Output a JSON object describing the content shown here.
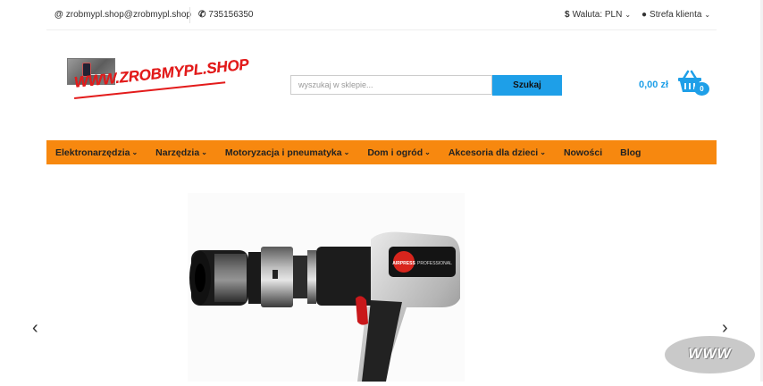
{
  "topbar": {
    "email": "zrobmypl.shop@zrobmypl.shop",
    "phone": "735156350",
    "currency_label": "Waluta: PLN",
    "account_label": "Strefa klienta"
  },
  "logo": {
    "text": "WWW.ZROBMYPL.SHOP"
  },
  "search": {
    "placeholder": "wyszukaj w sklepie...",
    "button_label": "Szukaj"
  },
  "cart": {
    "total": "0,00 zł",
    "count": "0"
  },
  "nav": {
    "items": [
      {
        "label": "Elektronarzędzia",
        "dropdown": true
      },
      {
        "label": "Narzędzia",
        "dropdown": true
      },
      {
        "label": "Motoryzacja i pneumatyka",
        "dropdown": true
      },
      {
        "label": "Dom i ogród",
        "dropdown": true
      },
      {
        "label": "Akcesoria dla dzieci",
        "dropdown": true
      },
      {
        "label": "Nowości",
        "dropdown": false
      },
      {
        "label": "Blog",
        "dropdown": false
      }
    ]
  },
  "slider": {
    "product_brand": "AIRPRESS",
    "product_series": "PROFESSIONAL",
    "prev_icon": "‹",
    "next_icon": "›"
  },
  "watermark": {
    "text": "WWW"
  },
  "colors": {
    "accent": "#1e9fe8",
    "nav_bg": "#f7880f",
    "logo_red": "#e31b1b"
  }
}
